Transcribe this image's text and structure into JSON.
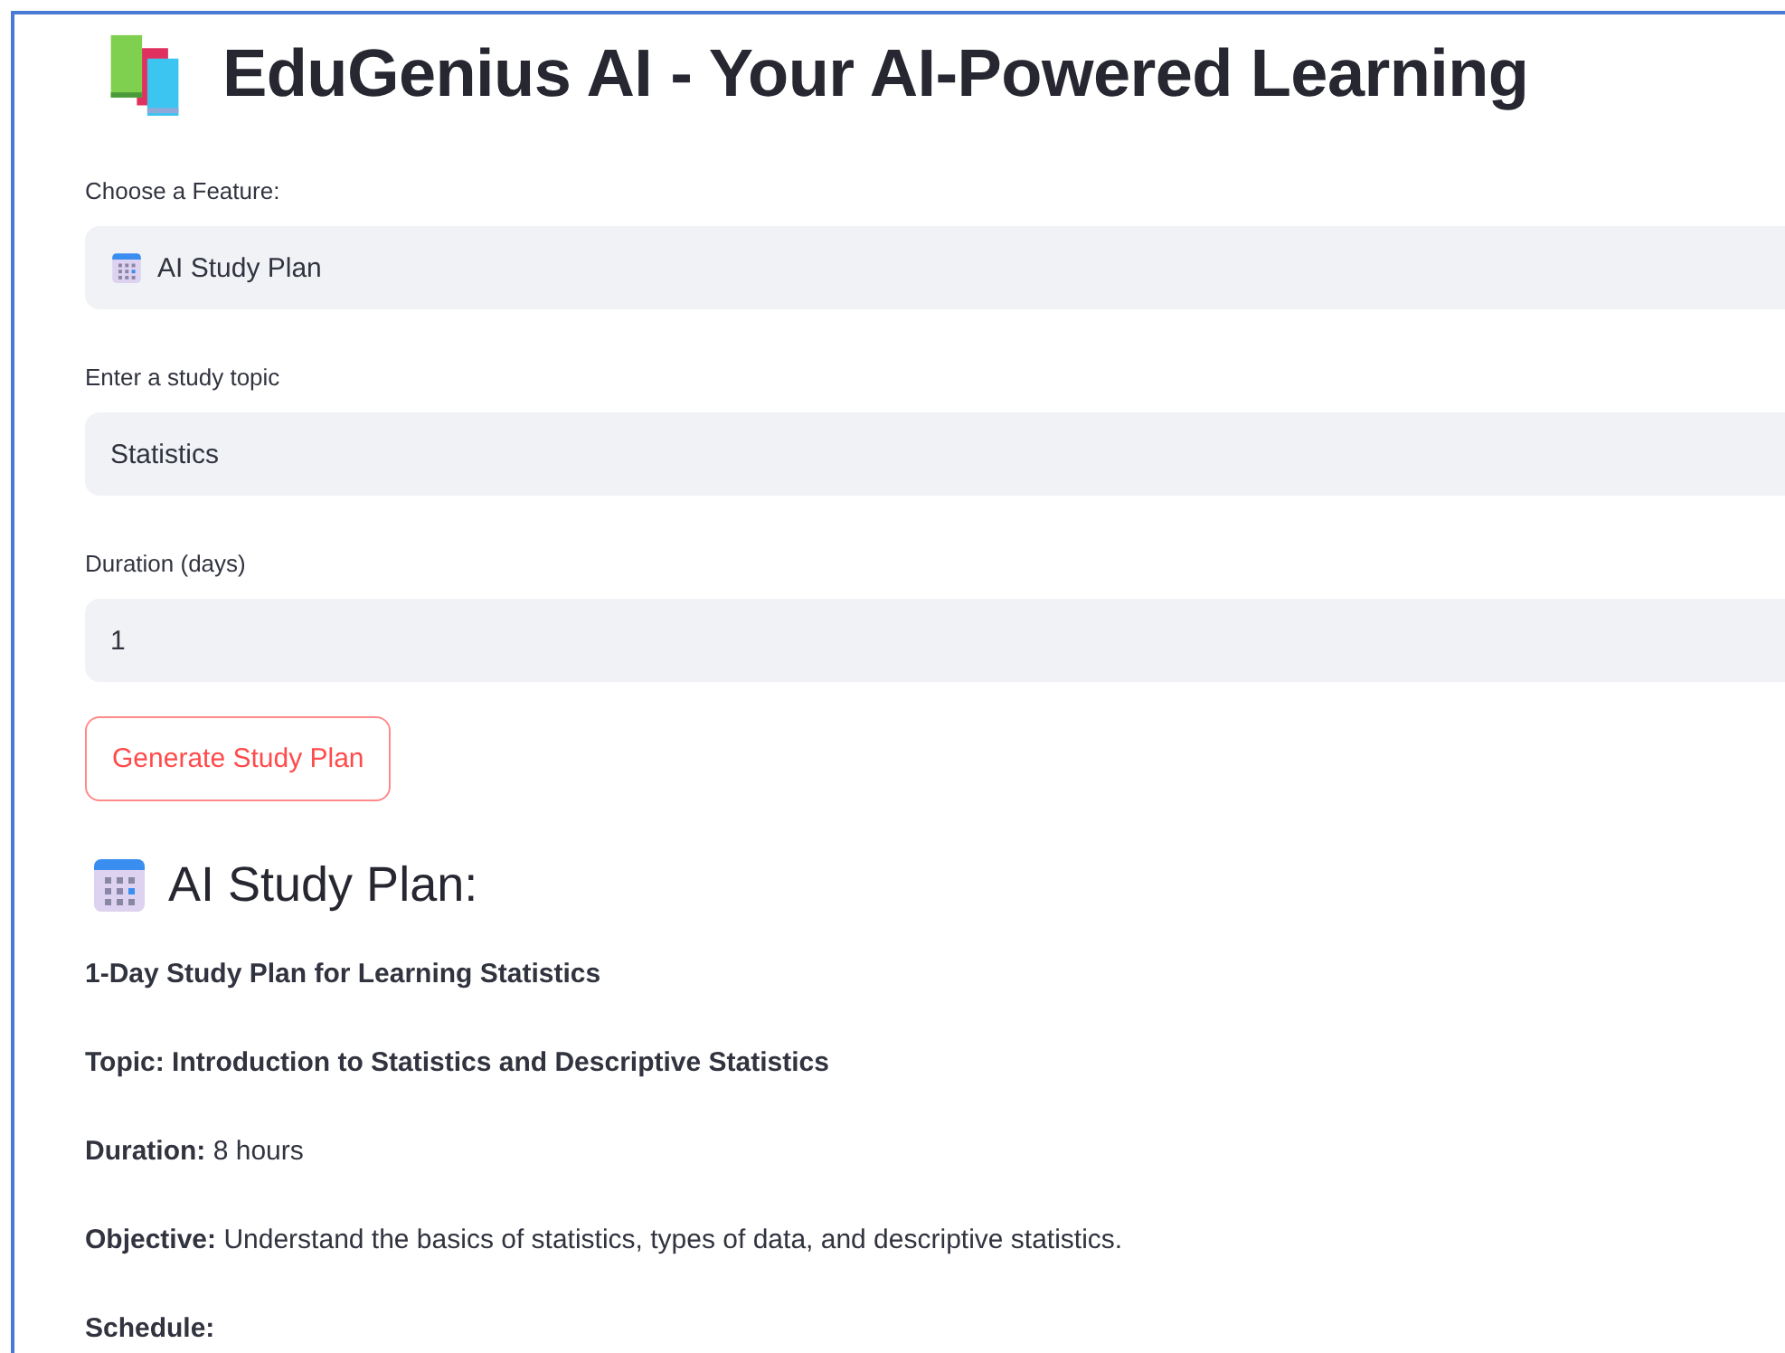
{
  "title": {
    "text": "EduGenius AI - Your AI-Powered Learning"
  },
  "form": [
    {
      "kind": "select",
      "label": "Choose a Feature:",
      "value": "AI Study Plan"
    },
    {
      "kind": "text",
      "label": "Enter a study topic",
      "value": "Statistics"
    },
    {
      "kind": "number",
      "label": "Duration (days)",
      "value": "1"
    }
  ],
  "button": {
    "label": "Generate Study Plan"
  },
  "result": {
    "heading": "AI Study Plan:",
    "paragraphs": [
      {
        "text": "1-Day Study Plan for Learning Statistics",
        "bold": true
      },
      {
        "text": "Topic: Introduction to Statistics and Descriptive Statistics",
        "bold": true
      },
      {
        "text": "**Duration:** 8 hours",
        "bold": false
      },
      {
        "text": "**Objective:** Understand the basics of statistics, types of data, and descriptive statistics.",
        "bold": false
      },
      {
        "text": "Schedule:",
        "bold": true
      }
    ]
  }
}
